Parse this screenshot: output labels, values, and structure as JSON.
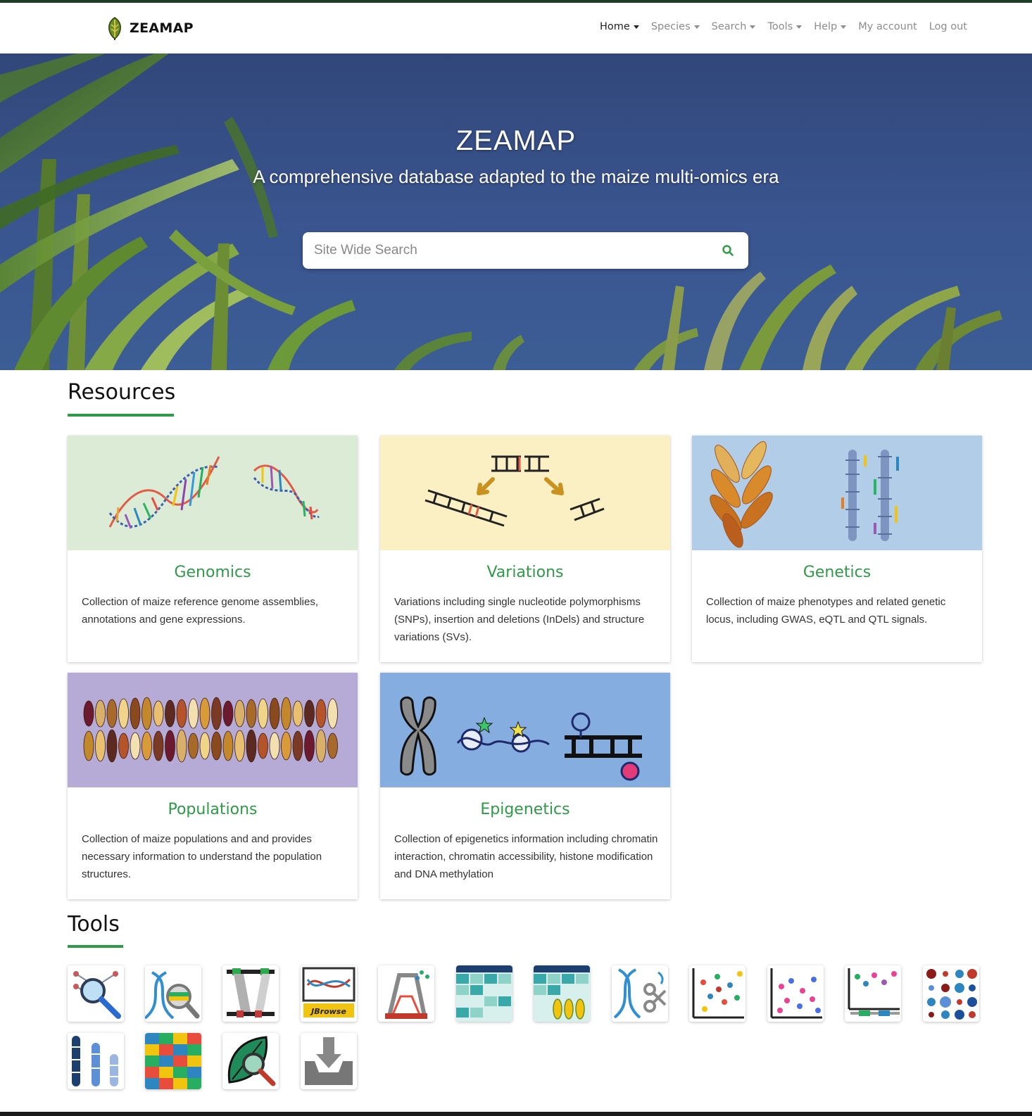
{
  "brand": {
    "name": "ZEAMAP"
  },
  "nav": {
    "items": [
      {
        "label": "Home",
        "has_dropdown": true,
        "active": true
      },
      {
        "label": "Species",
        "has_dropdown": true,
        "active": false
      },
      {
        "label": "Search",
        "has_dropdown": true,
        "active": false
      },
      {
        "label": "Tools",
        "has_dropdown": true,
        "active": false
      },
      {
        "label": "Help",
        "has_dropdown": true,
        "active": false
      },
      {
        "label": "My account",
        "has_dropdown": false,
        "active": false
      },
      {
        "label": "Log out",
        "has_dropdown": false,
        "active": false
      }
    ]
  },
  "hero": {
    "title": "ZEAMAP",
    "subtitle": "A comprehensive database adapted to the maize multi-omics era",
    "search": {
      "placeholder": "Site Wide Search",
      "value": ""
    }
  },
  "resources": {
    "heading": "Resources",
    "cards": [
      {
        "title": "Genomics",
        "text": "Collection of maize reference genome assemblies, annotations and gene expressions.",
        "bg_color": "#dcebd6"
      },
      {
        "title": "Variations",
        "text": "Variations including single nucleotide polymorphisms (SNPs), insertion and deletions (InDels) and structure variations (SVs).",
        "bg_color": "#fbefc4"
      },
      {
        "title": "Genetics",
        "text": "Collection of maize phenotypes and related genetic locus, including GWAS, eQTL and QTL signals.",
        "bg_color": "#b2cde8"
      },
      {
        "title": "Populations",
        "text": "Collection of maize populations and and provides necessary information to understand the population structures.",
        "bg_color": "#b6abd6"
      },
      {
        "title": "Epigenetics",
        "text": "Collection of epigenetics information including chromatin interaction, chromatin accessibility, histone modification and DNA methylation",
        "bg_color": "#86ade0"
      }
    ]
  },
  "tools": {
    "heading": "Tools",
    "items": [
      {
        "icon": "network-search-icon"
      },
      {
        "icon": "dna-magnifier-icon"
      },
      {
        "icon": "synteny-viewer-icon"
      },
      {
        "icon": "jbrowse-icon"
      },
      {
        "icon": "primer-design-icon"
      },
      {
        "icon": "expression-heatmap-icon"
      },
      {
        "icon": "expression-heatmap-corn-icon"
      },
      {
        "icon": "crispr-icon"
      },
      {
        "icon": "scatter-plot-icon"
      },
      {
        "icon": "trait-scatter-icon"
      },
      {
        "icon": "locus-plot-icon"
      },
      {
        "icon": "dot-matrix-icon"
      },
      {
        "icon": "chromosome-icon"
      },
      {
        "icon": "genotype-table-icon"
      },
      {
        "icon": "leaf-search-icon"
      },
      {
        "icon": "download-icon"
      }
    ]
  },
  "colors": {
    "accent": "#2f9a47",
    "nav_active": "#222222",
    "nav_inactive": "#8c8c8c"
  }
}
